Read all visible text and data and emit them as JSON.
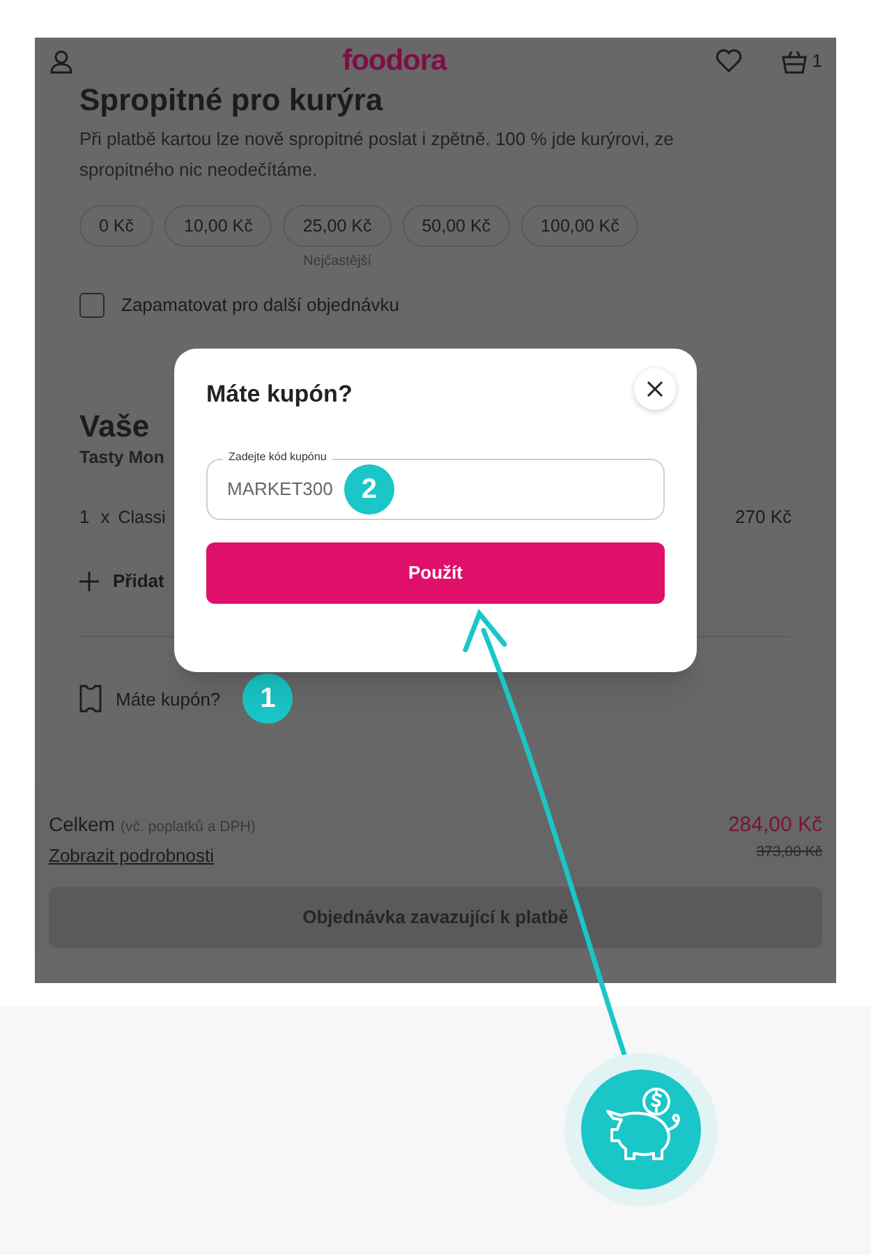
{
  "header": {
    "logo": "foodora",
    "cart_count": "1"
  },
  "tip": {
    "title": "Spropitné pro kurýra",
    "text": "Při platbě kartou lze nově spropitné poslat i zpětně. 100 % jde kurýrovi, ze spropitného nic neodečítáme.",
    "options": [
      {
        "label": "0 Kč",
        "selected": false
      },
      {
        "label": "10,00 Kč",
        "selected": false
      },
      {
        "label": "25,00 Kč",
        "selected": false,
        "note": "Nejčastější"
      },
      {
        "label": "50,00 Kč",
        "selected": false
      },
      {
        "label": "100,00 Kč",
        "selected": false
      }
    ],
    "remember": {
      "label": "Zapamatovat pro další objednávku",
      "checked": false
    }
  },
  "order": {
    "title": "Vaše",
    "restaurant": "Tasty Mon",
    "items": [
      {
        "quantity": "1",
        "separator": "x",
        "name": "Classi",
        "price": "270 Kč"
      }
    ],
    "add_label": "Přidat",
    "coupon_link": "Máte kupón?"
  },
  "summary": {
    "total_label": "Celkem",
    "total_note": "(vč. poplatků a DPH)",
    "details_link": "Zobrazit podrobnosti",
    "price": "284,00 Kč",
    "original_price": "373,00 Kč",
    "submit": {
      "label": "Objednávka zavazující k platbě",
      "disabled": true
    }
  },
  "dialog": {
    "title": "Máte kupón?",
    "field": {
      "label": "Zadejte kód kupónu",
      "value": "MARKET300"
    },
    "apply": "Použít"
  },
  "annotations": [
    {
      "label": "1"
    },
    {
      "label": "2"
    }
  ]
}
